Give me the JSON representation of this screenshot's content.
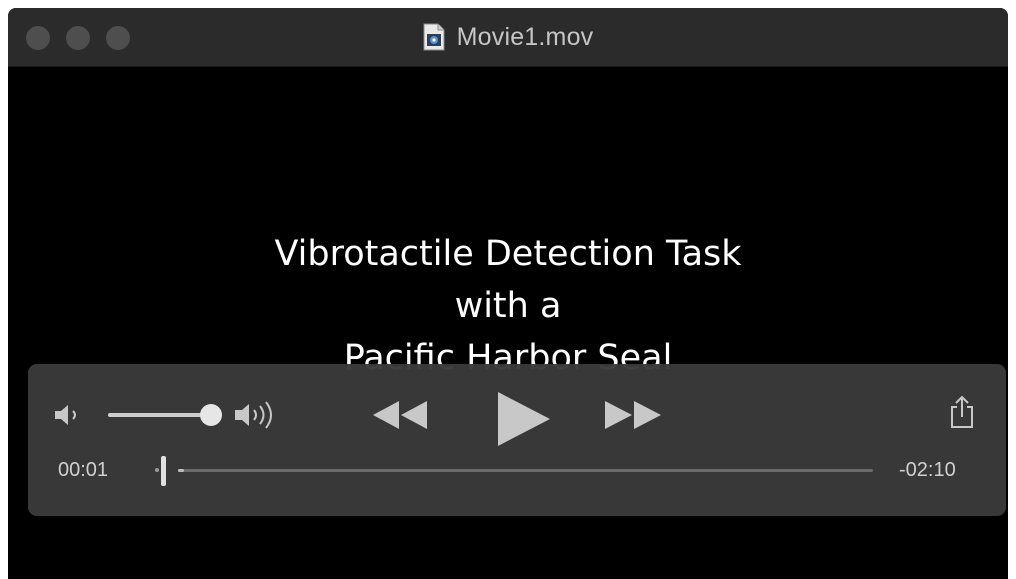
{
  "window": {
    "title": "Movie1.mov"
  },
  "icons": {
    "file": "movie-file-icon",
    "volume_low": "volume-low-icon",
    "volume_high": "volume-high-icon",
    "rewind": "rewind-icon",
    "play": "play-icon",
    "fast_forward": "fast-forward-icon",
    "share": "share-icon"
  },
  "video": {
    "lines": [
      "Vibrotactile Detection Task",
      "with a",
      "Pacific Harbor Seal"
    ]
  },
  "controls": {
    "elapsed": "00:01",
    "remaining": "-02:10",
    "volume_level": 1.0,
    "playback_progress": 0.008
  },
  "colors": {
    "titlebar": "#2b2b2b",
    "video_bg": "#000000",
    "controls_bg": "#3a3a3a",
    "icon": "#c8c8c8"
  }
}
